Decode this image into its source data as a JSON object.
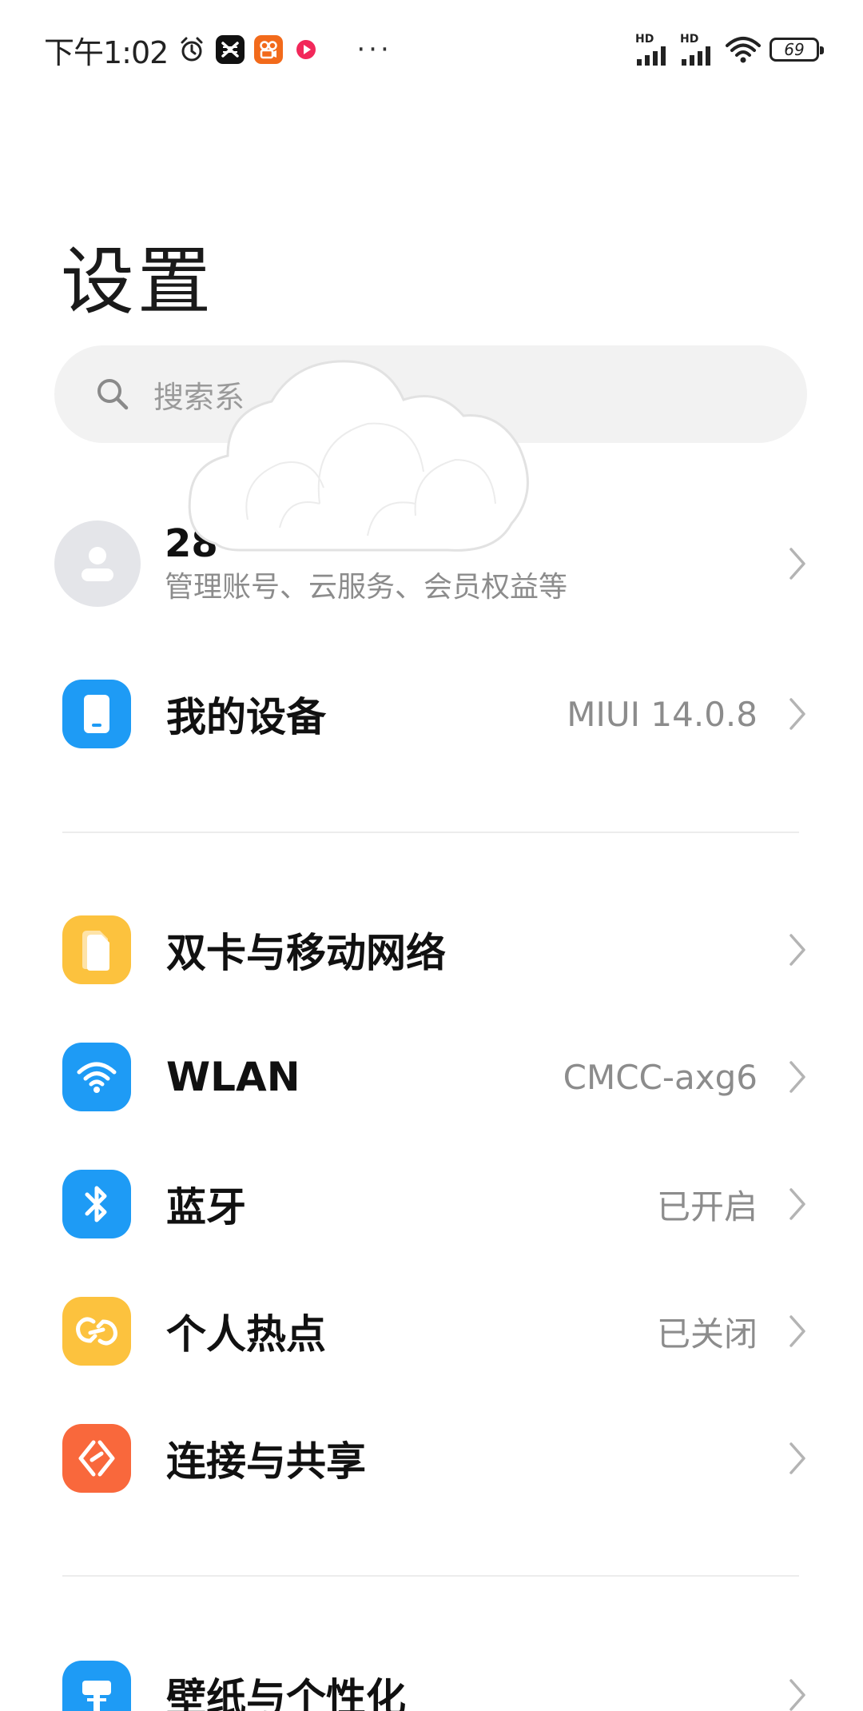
{
  "status_bar": {
    "time": "下午1:02",
    "more": "···",
    "signal_1_label": "HD",
    "signal_2_label": "HD",
    "battery": "69"
  },
  "header": {
    "title": "设置"
  },
  "search": {
    "placeholder": "搜索系"
  },
  "account": {
    "name": "28",
    "subtitle": "管理账号、云服务、会员权益等"
  },
  "my_device": {
    "label": "我的设备",
    "value": "MIUI 14.0.8",
    "icon_color": "#1e9bf5"
  },
  "network_section": [
    {
      "name": "sim",
      "label": "双卡与移动网络",
      "value": "",
      "icon": "sim-card-icon",
      "color": "#fcc23e"
    },
    {
      "name": "wlan",
      "label": "WLAN",
      "value": "CMCC-axg6",
      "icon": "wifi-icon",
      "color": "#1e9bf5"
    },
    {
      "name": "bluetooth",
      "label": "蓝牙",
      "value": "已开启",
      "icon": "bluetooth-icon",
      "color": "#1e9bf5"
    },
    {
      "name": "hotspot",
      "label": "个人热点",
      "value": "已关闭",
      "icon": "hotspot-icon",
      "color": "#fcc23e"
    },
    {
      "name": "connection",
      "label": "连接与共享",
      "value": "",
      "icon": "connection-share-icon",
      "color": "#f9683c"
    }
  ],
  "personalization_section": [
    {
      "name": "wallpaper",
      "label": "壁纸与个性化",
      "value": "",
      "icon": "wallpaper-icon",
      "color": "#1e9bf5"
    }
  ]
}
